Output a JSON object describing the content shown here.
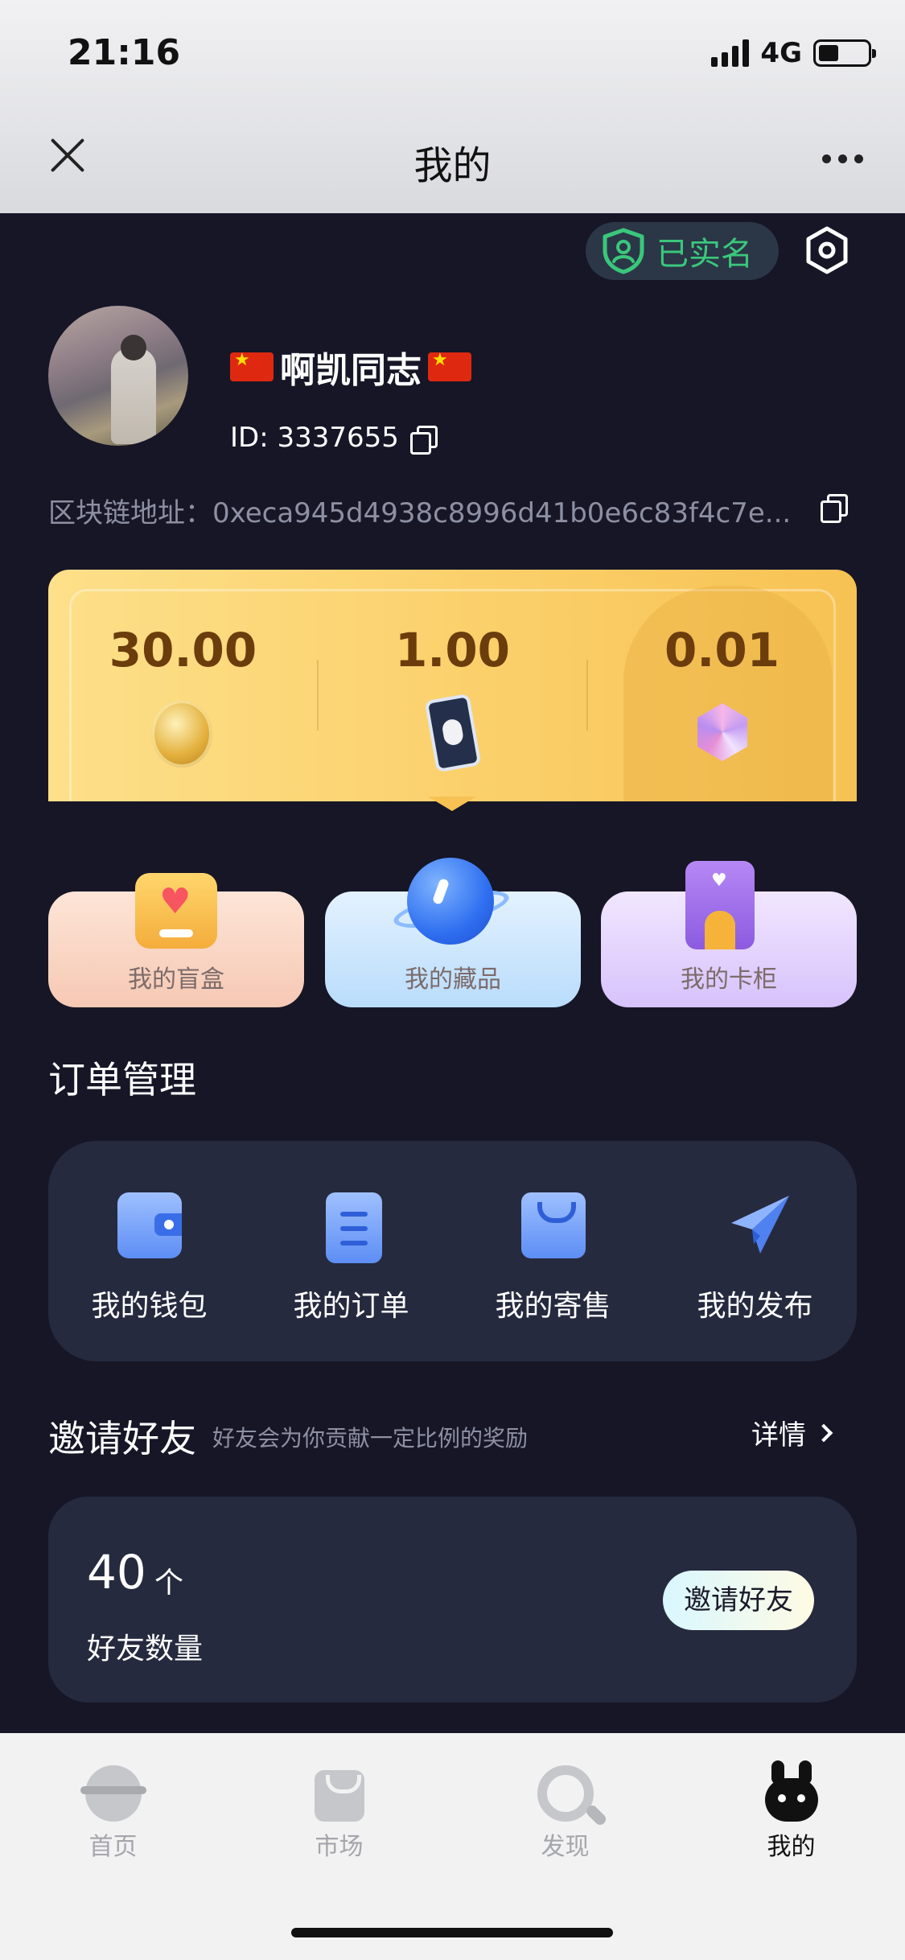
{
  "status_bar": {
    "time": "21:16",
    "network": "4G"
  },
  "nav": {
    "title": "我的"
  },
  "profile": {
    "verified_label": "已实名",
    "username": "啊凯同志",
    "id_text": "ID: 3337655",
    "chain_label": "区块链地址：",
    "chain_address": "0xeca945d4938c8996d41b0e6c83f4c7e...",
    "chain_display": "区块链地址：0xeca945d4938c8996d41b0e6c83f4c7e..."
  },
  "assets": [
    {
      "value": "30.00",
      "icon": "coin-icon"
    },
    {
      "value": "1.00",
      "icon": "card-icon"
    },
    {
      "value": "0.01",
      "icon": "gem-icon"
    }
  ],
  "features": [
    {
      "label": "我的盲盒",
      "icon": "gift-box-icon"
    },
    {
      "label": "我的藏品",
      "icon": "planet-icon"
    },
    {
      "label": "我的卡柜",
      "icon": "locker-icon"
    }
  ],
  "orders": {
    "title": "订单管理",
    "items": [
      {
        "label": "我的钱包",
        "icon": "wallet-icon"
      },
      {
        "label": "我的订单",
        "icon": "order-list-icon"
      },
      {
        "label": "我的寄售",
        "icon": "shopping-bag-icon"
      },
      {
        "label": "我的发布",
        "icon": "paper-plane-icon"
      }
    ]
  },
  "invite": {
    "title": "邀请好友",
    "subtitle": "好友会为你贡献一定比例的奖励",
    "detail_label": "详情",
    "count": "40",
    "unit": "个",
    "count_label": "好友数量",
    "button_label": "邀请好友"
  },
  "tabbar": {
    "items": [
      {
        "label": "首页",
        "icon": "home-icon"
      },
      {
        "label": "市场",
        "icon": "market-bag-icon"
      },
      {
        "label": "发现",
        "icon": "discover-search-icon"
      },
      {
        "label": "我的",
        "icon": "rabbit-profile-icon",
        "active": true
      }
    ]
  },
  "colors": {
    "background": "#161627",
    "card": "#262a3e",
    "verified_green": "#3ac77b",
    "asset_text": "#6b3c0c"
  }
}
